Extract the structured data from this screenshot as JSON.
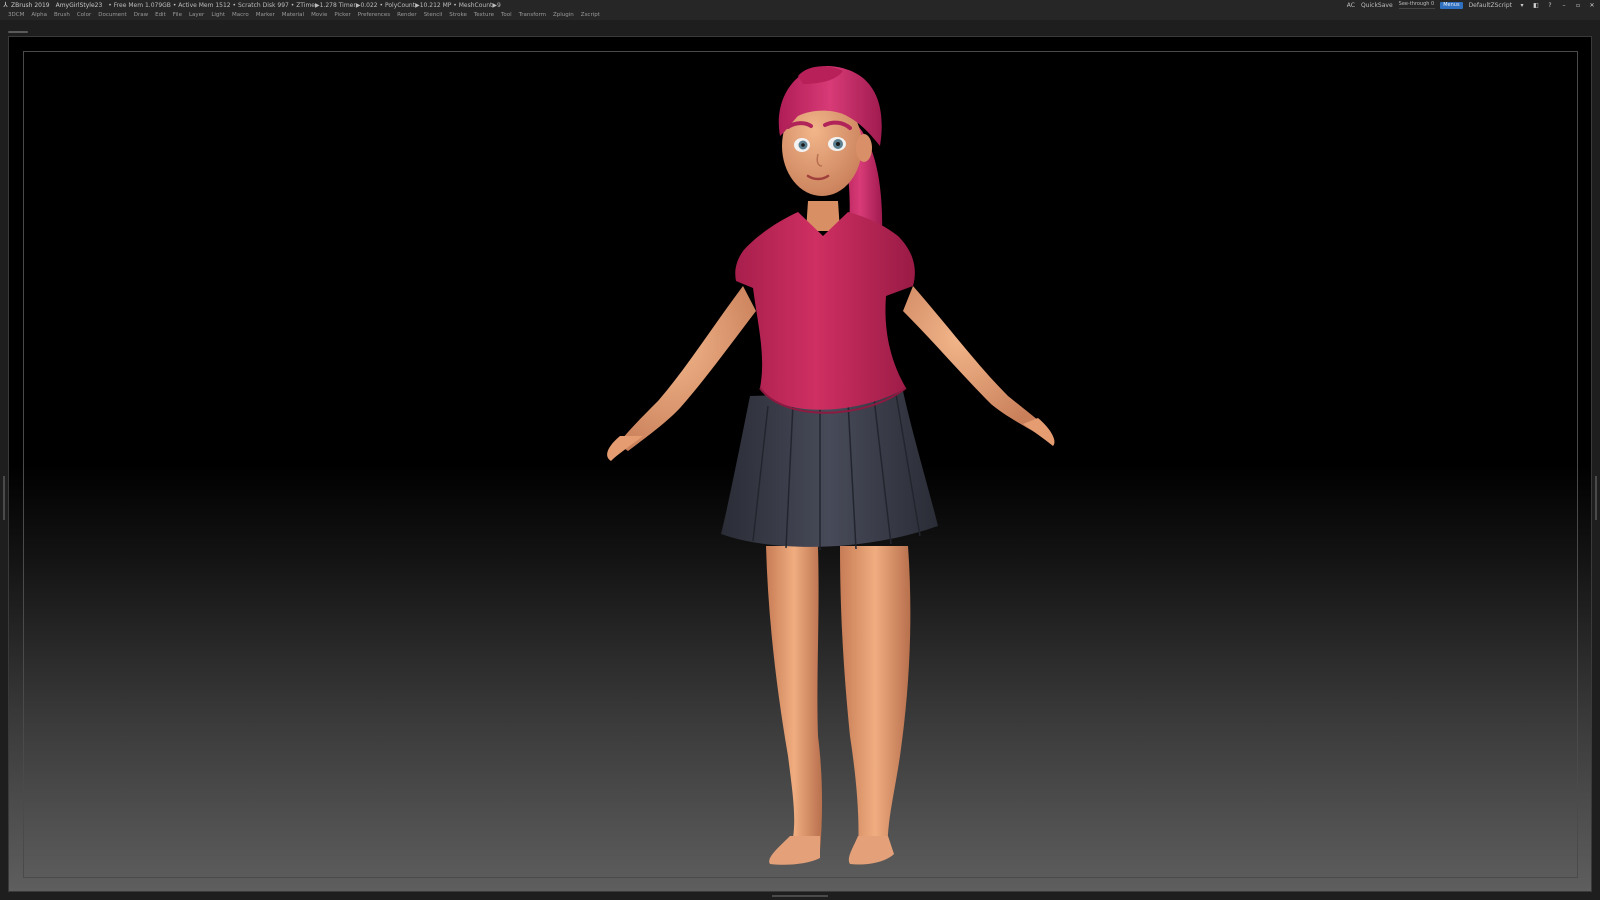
{
  "topbar": {
    "app_name": "ZBrush 2019",
    "project": "AmyGirlStyle23",
    "stats": "• Free Mem 1.079GB • Active Mem 1512 • Scratch Disk 997 • ZTime▶1.278 Timer▶0.022 • PolyCount▶10.212 MP • MeshCount▶9",
    "ac": "AC",
    "quicksave": "QuickSave",
    "see_through_label": "See-through",
    "see_through_value": "0",
    "see_through_fraction": 0,
    "menus_label": "Menus",
    "script_label": "DefaultZScript"
  },
  "menubar": {
    "items": [
      "3DCM",
      "Alpha",
      "Brush",
      "Color",
      "Document",
      "Draw",
      "Edit",
      "File",
      "Layer",
      "Light",
      "Macro",
      "Marker",
      "Material",
      "Movie",
      "Picker",
      "Preferences",
      "Render",
      "Stencil",
      "Stroke",
      "Texture",
      "Tool",
      "Transform",
      "Zplugin",
      "Zscript"
    ]
  },
  "colors": {
    "shirt": "#c0285a",
    "hair": "#c8286a",
    "skin": "#e8a478",
    "skirt": "#3a3c48",
    "menus_pill": "#2f6fbf"
  },
  "icons": {
    "logo": "zbrush-logo-icon",
    "minimize": "minimize-icon",
    "maximize": "maximize-icon",
    "close": "close-icon"
  }
}
